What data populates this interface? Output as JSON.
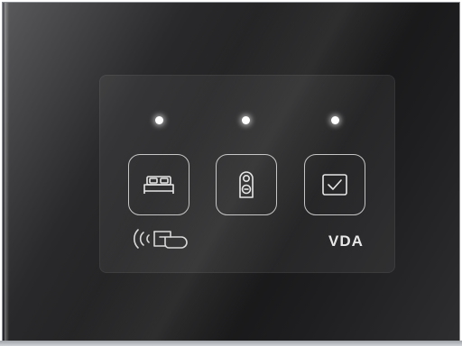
{
  "brand": {
    "text": "VDA"
  },
  "leds": [
    {
      "name": "led-housekeeping",
      "on": true
    },
    {
      "name": "led-do-not-disturb",
      "on": true
    },
    {
      "name": "led-done",
      "on": true
    }
  ],
  "buttons": [
    {
      "name": "housekeeping-button",
      "icon": "bed-icon"
    },
    {
      "name": "do-not-disturb-button",
      "icon": "door-hanger-icon"
    },
    {
      "name": "done-button",
      "icon": "checkmark-icon"
    }
  ],
  "card_reader": {
    "icon": "contactless-card-icon"
  },
  "colors": {
    "panel": "#1a1a1c",
    "led": "#ffffff",
    "outline": "#e0e0e0"
  }
}
